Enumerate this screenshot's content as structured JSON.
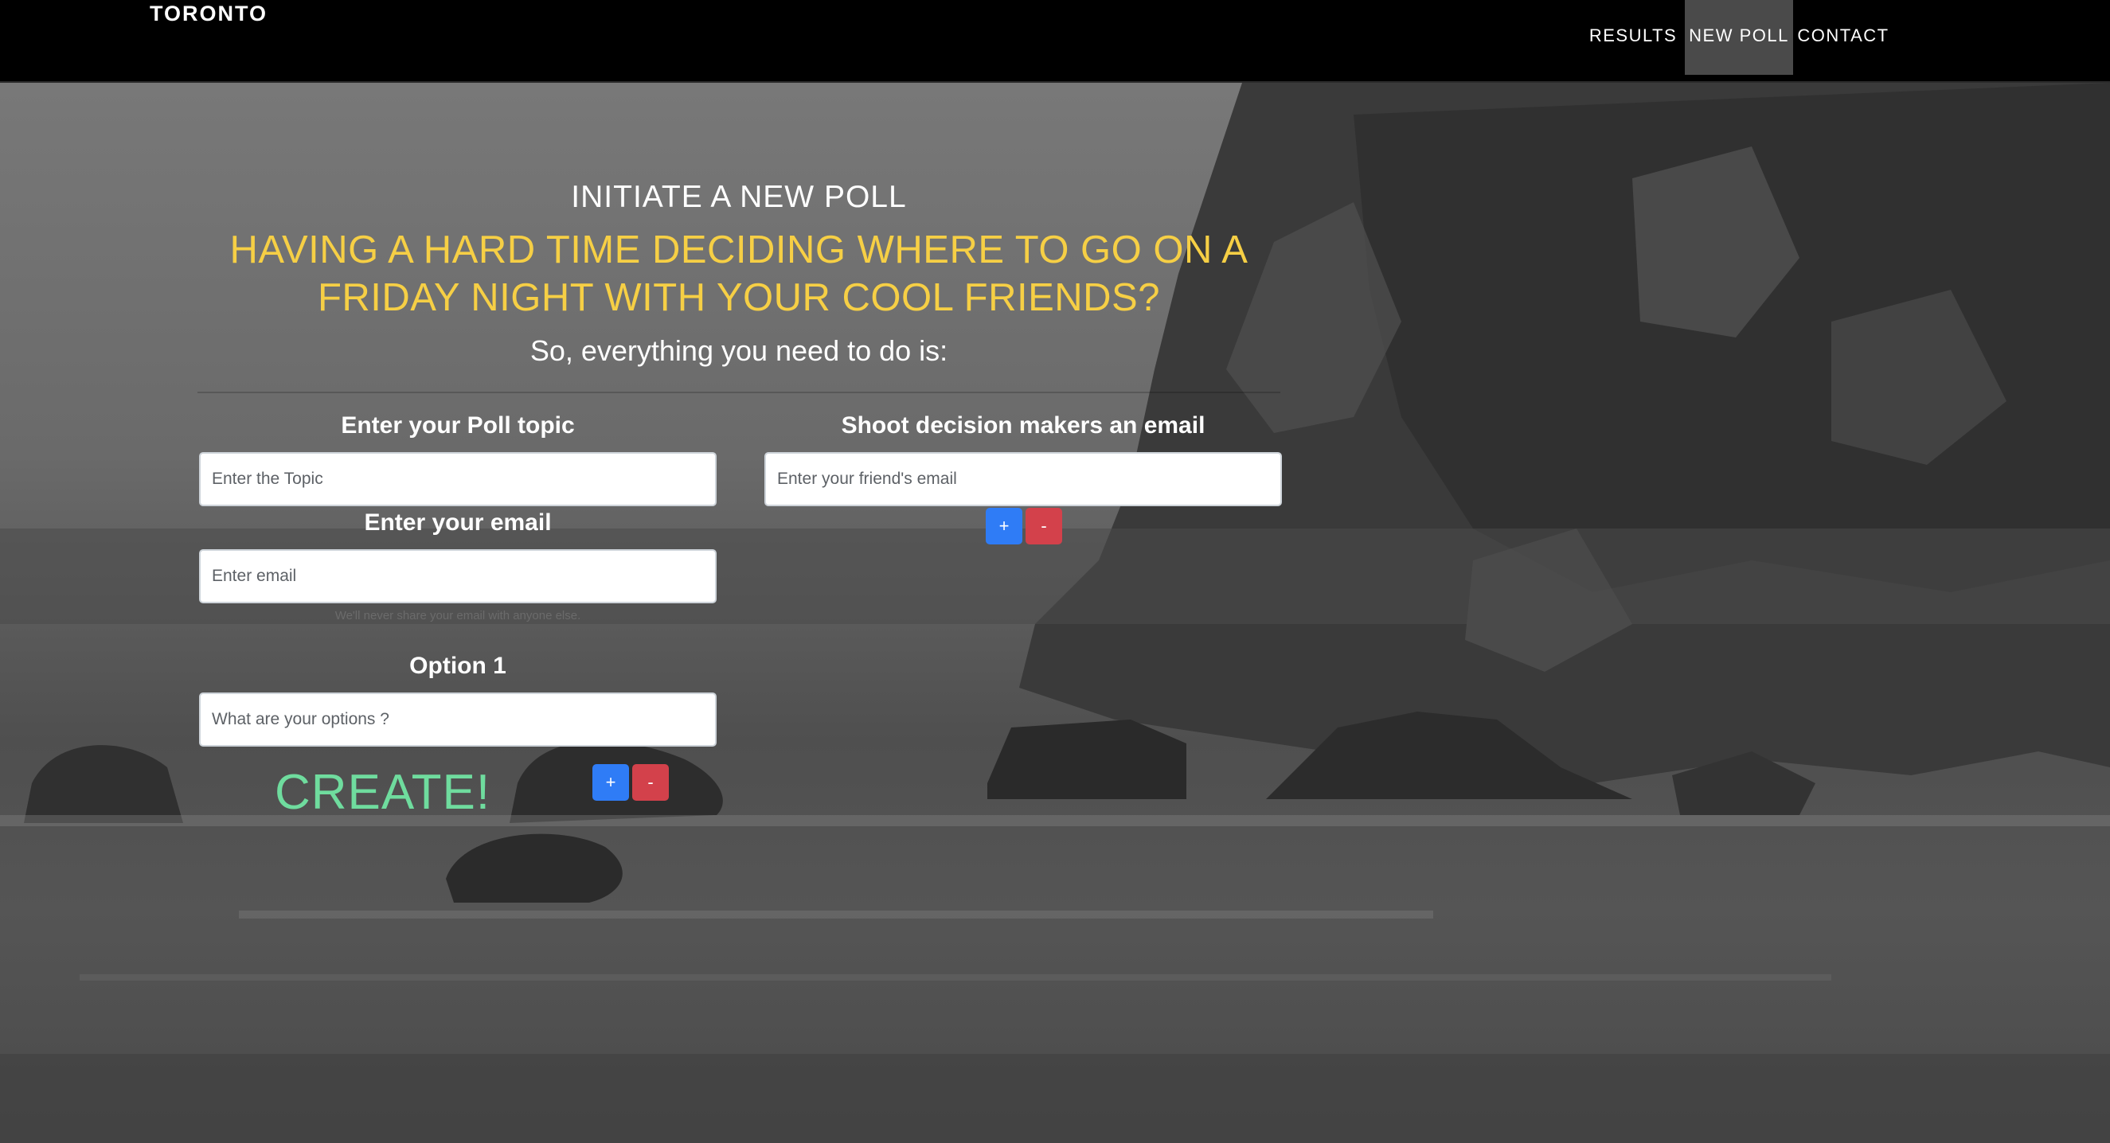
{
  "navbar": {
    "brand": "TORONTO",
    "links": [
      {
        "label": "RESULTS",
        "active": false
      },
      {
        "label": "NEW POLL",
        "active": true
      },
      {
        "label": "CONTACT",
        "active": false
      }
    ]
  },
  "hero": {
    "title": "INITIATE A NEW POLL",
    "tagline_line1": "HAVING A HARD TIME DECIDING WHERE TO GO ON A",
    "tagline_line2": "FRIDAY NIGHT WITH YOUR COOL FRIENDS?",
    "subtitle": "So, everything you need to do is:"
  },
  "form": {
    "topic": {
      "label": "Enter your Poll topic",
      "placeholder": "Enter the Topic",
      "value": ""
    },
    "email": {
      "label": "Enter your email",
      "placeholder": "Enter email",
      "value": "",
      "hint": "We'll never share your email with anyone else."
    },
    "option": {
      "label": "Option 1",
      "placeholder": "What are your options ?",
      "value": ""
    },
    "friends": {
      "label": "Shoot decision makers an email",
      "placeholder": "Enter your friend's email",
      "value": ""
    },
    "add_label": "+",
    "remove_label": "-",
    "create_label": "CREATE!"
  },
  "colors": {
    "navbar_bg": "#000000",
    "active_link_bg": "#4a4a4a",
    "tagline": "#f6cf45",
    "create": "#6fdc9e",
    "plus_button": "#2f7cf6",
    "minus_button": "#d3414b"
  }
}
